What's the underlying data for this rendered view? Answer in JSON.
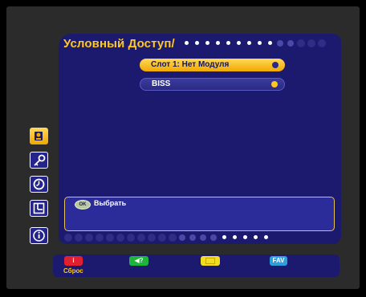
{
  "screen": {
    "title": "Условный Доступ/"
  },
  "menu": {
    "items": [
      {
        "label": "Слот 1: Нет Модуля",
        "selected": true
      },
      {
        "label": "BISS",
        "selected": false
      }
    ]
  },
  "sidebar": {
    "icons": [
      {
        "icon": "camera-icon",
        "active": true
      },
      {
        "icon": "key-icon",
        "active": false
      },
      {
        "icon": "clock-icon",
        "active": false
      },
      {
        "icon": "layout-icon",
        "active": false
      },
      {
        "icon": "info-icon",
        "active": false
      }
    ]
  },
  "info_box": {
    "ok_icon_text": "OK",
    "ok_label": "Выбрать"
  },
  "keys": {
    "red": {
      "label": "i",
      "caption": "Сброс"
    },
    "green": {
      "label": "◀?"
    },
    "yellow": {
      "label": ""
    },
    "blue": {
      "label": "FAV"
    }
  },
  "colors": {
    "accent_yellow": "#ffc81e",
    "panel_blue": "#1c1a6e",
    "red_key": "#e02030",
    "green_key": "#1eb43c",
    "yellow_key": "#f3dd20",
    "blue_key": "#2da0dc"
  }
}
